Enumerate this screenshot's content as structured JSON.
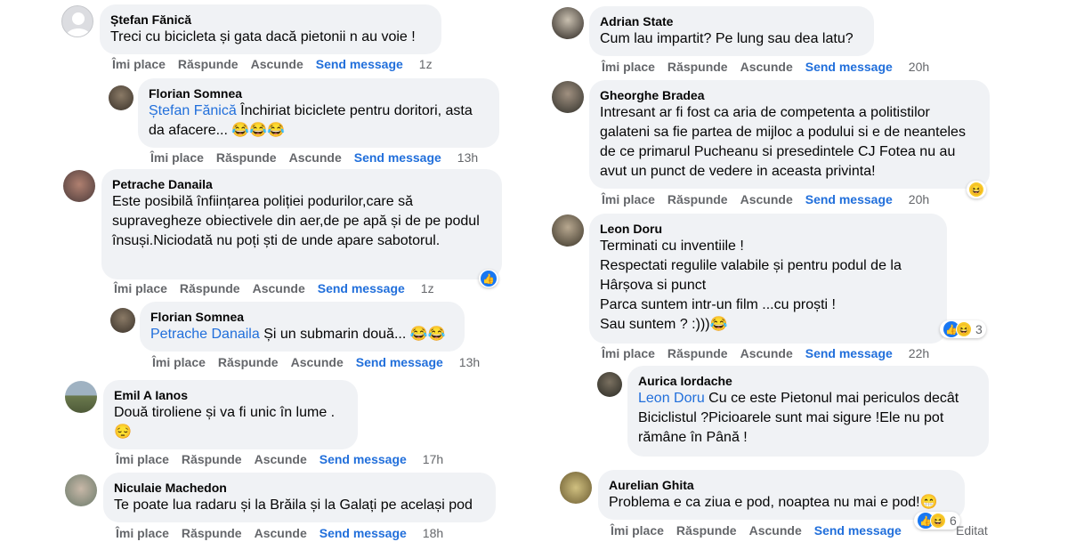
{
  "actions": {
    "like": "Îmi place",
    "reply": "Răspunde",
    "hide": "Ascunde",
    "send": "Send message"
  },
  "left": [
    {
      "author": "Ștefan Fănică",
      "text": "Treci cu bicicleta și gata dacă pietonii n au voie !",
      "time": "1z"
    },
    {
      "author": "Florian Somnea",
      "mention": "Ștefan Fănică",
      "text": " Închiriat biciclete pentru doritori, asta da afacere... 😂😂😂",
      "time": "13h"
    },
    {
      "author": "Petrache Danaila",
      "text": "Este posibilă înființarea poliției podurilor,care să supravegheze obiectivele din aer,de pe apă și de pe podul însuși.Niciodată nu poți ști de unde apare sabotorul.",
      "time": "1z"
    },
    {
      "author": "Florian Somnea",
      "mention": "Petrache Danaila",
      "text": " Și un submarin două... 😂😂",
      "time": "13h"
    },
    {
      "author": "Emil A Ianos",
      "text": "Două tiroliene și va fi unic în lume .\n😔",
      "time": "17h"
    },
    {
      "author": "Niculaie Machedon",
      "text": "Te poate lua radaru și la Brăila și la Galați pe același pod",
      "time": "18h"
    }
  ],
  "right": [
    {
      "author": "Adrian State",
      "text": "Cum lau impartit? Pe lung sau dea latu?",
      "time": "20h"
    },
    {
      "author": "Gheorghe Bradea",
      "text": "Intresant ar fi fost ca aria de competenta a politistilor galateni sa fie partea de mijloc a podului si e de neanteles de ce primarul Pucheanu si presedintele CJ Fotea nu au avut un punct de vedere in aceasta privinta!",
      "time": "20h"
    },
    {
      "author": "Leon Doru",
      "text": "Terminati cu inventiile !\nRespectati regulile valabile și pentru podul de la Hârșova si punct\nParca suntem intr-un film ...cu proști !\nSau suntem ? :)))😂",
      "time": "22h",
      "reaction_count": "3"
    },
    {
      "author": "Aurica Iordache",
      "mention": "Leon Doru",
      "text": " Cu ce este Pietonul mai periculos decât Biciclistul ?Picioarele sunt mai sigure !Ele nu pot rămâne în Până !"
    },
    {
      "author": "Aurelian Ghita",
      "text": "Problema e ca ziua e pod, noaptea nu mai e pod!😁",
      "reaction_count": "6",
      "edited": "Editat"
    }
  ],
  "colors": {
    "bubble": "#f0f2f5",
    "link": "#216fdb",
    "meta": "#65676b",
    "like": "#1877f2"
  }
}
